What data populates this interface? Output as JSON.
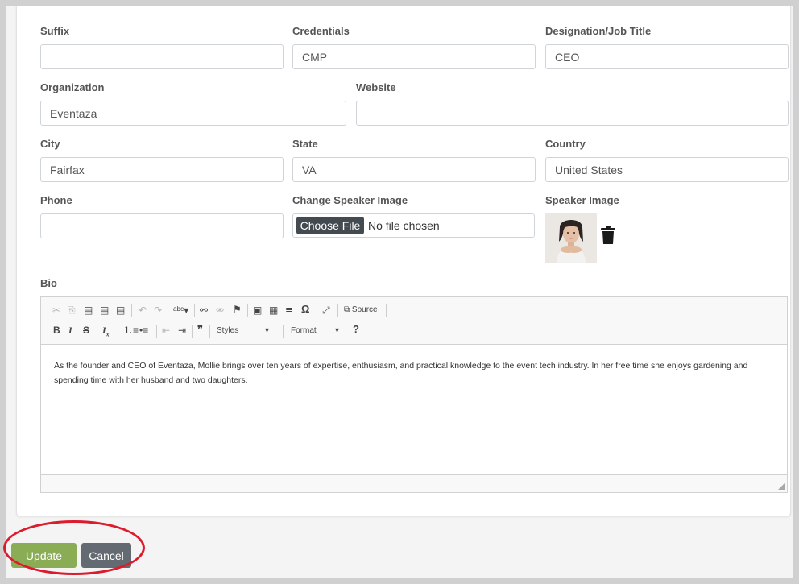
{
  "form": {
    "suffix": {
      "label": "Suffix",
      "value": ""
    },
    "credentials": {
      "label": "Credentials",
      "value": "CMP"
    },
    "designation": {
      "label": "Designation/Job Title",
      "value": "CEO"
    },
    "organization": {
      "label": "Organization",
      "value": "Eventaza"
    },
    "website": {
      "label": "Website",
      "value": ""
    },
    "city": {
      "label": "City",
      "value": "Fairfax"
    },
    "state": {
      "label": "State",
      "value": "VA"
    },
    "country": {
      "label": "Country",
      "value": "United States"
    },
    "phone": {
      "label": "Phone",
      "value": ""
    },
    "change_image": {
      "label": "Change Speaker Image",
      "button": "Choose File",
      "status": "No file chosen"
    },
    "speaker_image": {
      "label": "Speaker Image"
    },
    "bio": {
      "label": "Bio",
      "text": "As the founder and CEO of Eventaza, Mollie brings over ten years of expertise, enthusiasm, and practical knowledge to the event tech industry. In her free time she enjoys gardening and spending time with her husband and two daughters."
    }
  },
  "editor_toolbar": {
    "source_label": "Source",
    "styles_label": "Styles",
    "format_label": "Format",
    "help_label": "?"
  },
  "actions": {
    "update": "Update",
    "cancel": "Cancel"
  },
  "colors": {
    "update": "#8aac55",
    "cancel": "#646a71",
    "highlight": "#dc1c2d"
  }
}
